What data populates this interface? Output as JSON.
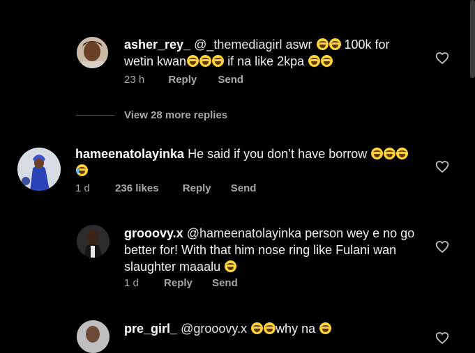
{
  "comments": [
    {
      "username": "asher_rey_",
      "mention": "@_themediagirl",
      "line1_text": "aswr",
      "line1_tail": "100k for",
      "line2_text": "wetin kwan",
      "line2_mid": "if na like 2kpa",
      "time": "23 h",
      "reply": "Reply",
      "send": "Send"
    },
    {
      "username": "hameenatolayinka",
      "text": "He said if you don’t have borrow",
      "time": "1 d",
      "likes": "236 likes",
      "reply": "Reply",
      "send": "Send"
    },
    {
      "username": "grooovy.x",
      "mention": "@hameenatolayinka",
      "line1_text": "person wey e no go",
      "line2_text": "better for! With that him nose ring like Fulani wan",
      "line3_text": "slaughter maaalu",
      "time": "1 d",
      "reply": "Reply",
      "send": "Send"
    },
    {
      "username": "pre_girl_",
      "mention": "@grooovy.x",
      "text": "why na"
    }
  ],
  "view_more": "View 28 more replies",
  "colors": {
    "background": "#000000",
    "meta": "#a8a8a8",
    "emoji": "#ffd43a"
  }
}
